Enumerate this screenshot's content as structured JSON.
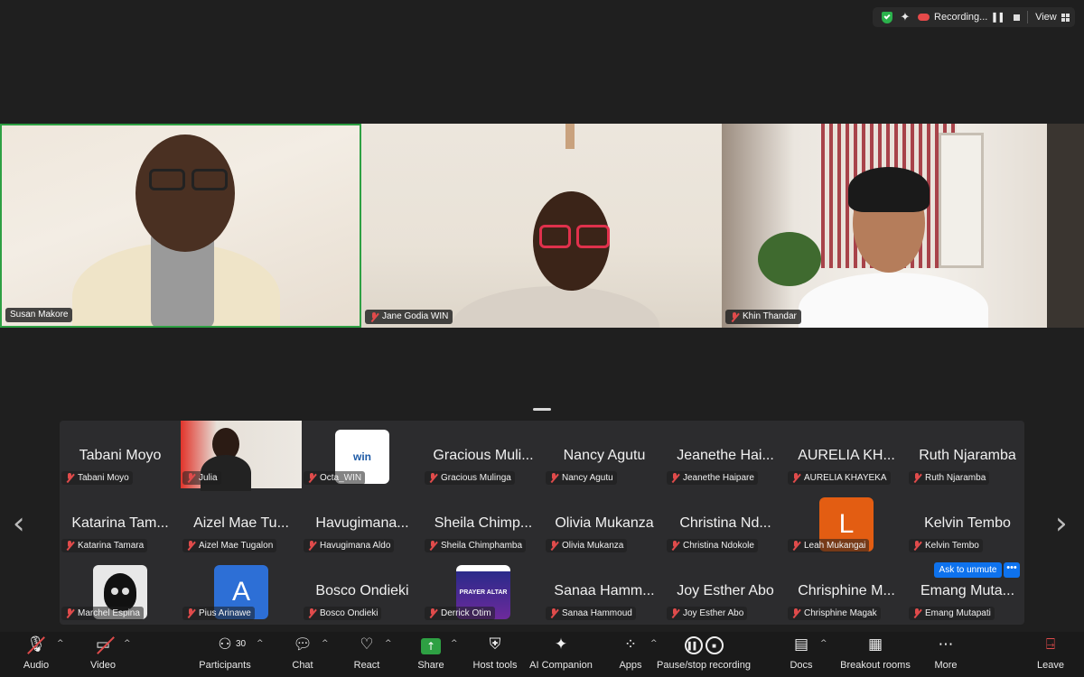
{
  "topbar": {
    "recording_label": "Recording...",
    "view_label": "View"
  },
  "main_videos": [
    {
      "name": "Susan Makore",
      "muted": false
    },
    {
      "name": "Jane Godia WIN",
      "muted": true
    },
    {
      "name": "Khin Thandar",
      "muted": true
    }
  ],
  "gallery": {
    "rows": [
      [
        {
          "big": "Tabani Moyo",
          "name": "Tabani Moyo"
        },
        {
          "big": "",
          "name": "Julia",
          "kind": "photo-julia"
        },
        {
          "big": "",
          "name": "Octa_WIN",
          "kind": "logo-win"
        },
        {
          "big": "Gracious Muli...",
          "name": "Gracious Mulinga"
        },
        {
          "big": "Nancy Agutu",
          "name": "Nancy Agutu"
        },
        {
          "big": "Jeanethe Hai...",
          "name": "Jeanethe Haipare"
        },
        {
          "big": "AURELIA KH...",
          "name": "AURELIA KHAYEKA"
        },
        {
          "big": "Ruth Njaramba",
          "name": "Ruth Njaramba"
        }
      ],
      [
        {
          "big": "Katarina Tam...",
          "name": "Katarina Tamara"
        },
        {
          "big": "Aizel Mae Tu...",
          "name": "Aizel Mae Tugalon"
        },
        {
          "big": "Havugimana...",
          "name": "Havugimana Aldo"
        },
        {
          "big": "Sheila Chimp...",
          "name": "Sheila Chimphamba"
        },
        {
          "big": "Olivia Mukanza",
          "name": "Olivia Mukanza"
        },
        {
          "big": "Christina Nd...",
          "name": "Christina Ndokole"
        },
        {
          "big": "",
          "name": "Leah Mukangai",
          "kind": "avatar-L"
        },
        {
          "big": "Kelvin Tembo",
          "name": "Kelvin Tembo"
        }
      ],
      [
        {
          "big": "",
          "name": "Marchel Espina",
          "kind": "photo-marchel"
        },
        {
          "big": "",
          "name": "Pius Arinawe",
          "kind": "avatar-A"
        },
        {
          "big": "Bosco Ondieki",
          "name": "Bosco Ondieki"
        },
        {
          "big": "",
          "name": "Derrick Otim",
          "kind": "poster-prayer"
        },
        {
          "big": "Sanaa Hamm...",
          "name": "Sanaa Hammoud"
        },
        {
          "big": "Joy Esther Abo",
          "name": "Joy Esther Abo"
        },
        {
          "big": "Chrisphine M...",
          "name": "Chrisphine Magak"
        },
        {
          "big": "Emang Muta...",
          "name": "Emang Mutapati"
        }
      ]
    ],
    "avatar_letters": {
      "leah": "L",
      "pius": "A"
    },
    "poster_text": "PRAYER ALTAR",
    "logo_text": "win",
    "ask_to_unmute": "Ask to unmute",
    "more": "•••"
  },
  "toolbar": {
    "audio": "Audio",
    "video": "Video",
    "participants": "Participants",
    "participants_count": "30",
    "chat": "Chat",
    "react": "React",
    "share": "Share",
    "host_tools": "Host tools",
    "ai_companion": "AI Companion",
    "apps": "Apps",
    "pause_stop": "Pause/stop recording",
    "docs": "Docs",
    "breakout": "Breakout rooms",
    "more": "More",
    "leave": "Leave"
  },
  "colors": {
    "accent_blue": "#0e72ed",
    "active_speaker": "#2ea043",
    "muted_red": "#e04b4b",
    "leah_avatar": "#e35d12",
    "pius_avatar": "#2d6fd6"
  }
}
